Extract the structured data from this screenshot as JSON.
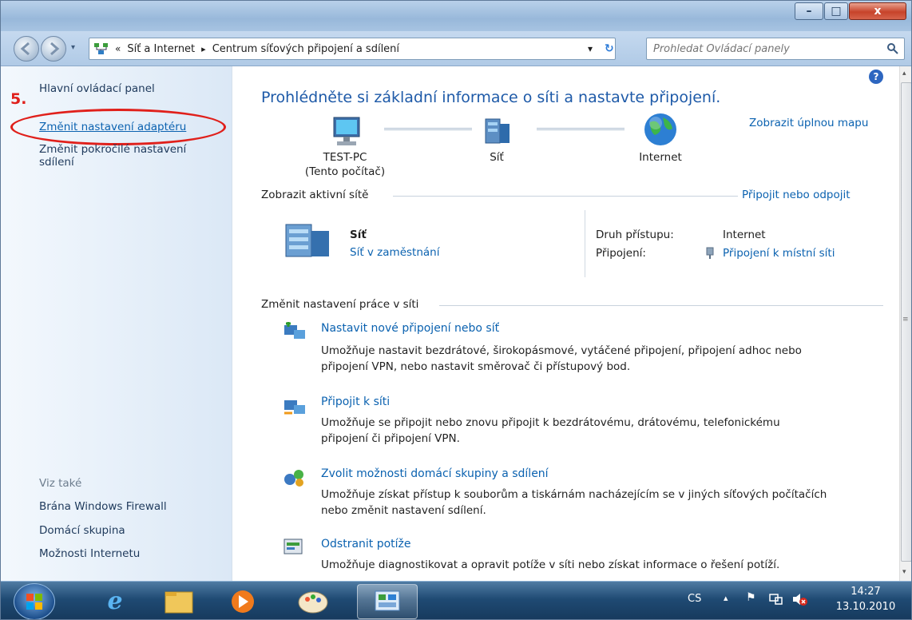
{
  "window": {
    "minimize_label": "–",
    "maximize_label": "□",
    "close_label": "x"
  },
  "address": {
    "chevron": "«",
    "crumb1": "Síť a Internet",
    "sep": "▸",
    "crumb2": "Centrum síťových připojení a sdílení",
    "dropdown": "▾",
    "refresh": "↻"
  },
  "search": {
    "placeholder": "Prohledat Ovládací panely"
  },
  "sidebar": {
    "home": "Hlavní ovládací panel",
    "step_marker": "5.",
    "change_adapter": "Změnit nastavení adaptéru",
    "change_advanced_line1": "Změnit pokročilé nastavení",
    "change_advanced_line2": "sdílení",
    "see_also": "Viz také",
    "links": [
      "Brána Windows Firewall",
      "Domácí skupina",
      "Možnosti Internetu"
    ]
  },
  "main": {
    "heading": "Prohlédněte si základní informace o síti a nastavte připojení.",
    "full_map": "Zobrazit úplnou mapu",
    "map": {
      "computer_name": "TEST-PC",
      "computer_sub": "(Tento počítač)",
      "network": "Síť",
      "internet": "Internet"
    },
    "active_networks": "Zobrazit aktivní sítě",
    "connect_disconnect": "Připojit nebo odpojit",
    "network_name": "Síť",
    "network_type": "Síť v zaměstnání",
    "access_type_label": "Druh přístupu:",
    "access_type_value": "Internet",
    "connections_label": "Připojení:",
    "connections_value": "Připojení k místní síti",
    "change_settings": "Změnit nastavení práce v síti",
    "tasks": [
      {
        "title": "Nastavit nové připojení nebo síť",
        "desc1": "Umožňuje nastavit bezdrátové, širokopásmové, vytáčené připojení, připojení adhoc nebo",
        "desc2": "připojení VPN, nebo nastavit směrovač či přístupový bod."
      },
      {
        "title": "Připojit k síti",
        "desc1": "Umožňuje se připojit nebo znovu připojit k bezdrátovému, drátovému, telefonickému",
        "desc2": "připojení či připojení VPN."
      },
      {
        "title": "Zvolit možnosti domácí skupiny a sdílení",
        "desc1": "Umožňuje získat přístup k souborům a tiskárnám nacházejícím se v jiných síťových počítačích",
        "desc2": "nebo změnit nastavení sdílení."
      },
      {
        "title": "Odstranit potíže",
        "desc1": "Umožňuje diagnostikovat a opravit potíže v síti nebo získat informace o řešení potíží.",
        "desc2": ""
      }
    ]
  },
  "taskbar": {
    "lang": "CS",
    "time": "14:27",
    "date": "13.10.2010"
  },
  "colors": {
    "link": "#0b62b0",
    "highlight_ring": "#e0201b",
    "marker": "#e0201b"
  }
}
